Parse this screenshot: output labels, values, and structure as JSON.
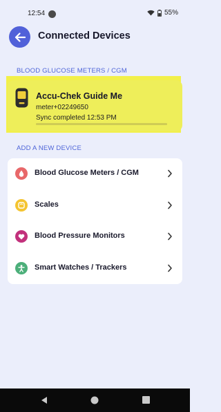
{
  "status_bar": {
    "time": "12:54",
    "battery": "55%"
  },
  "header": {
    "title": "Connected Devices",
    "back_icon": "arrow-left-icon"
  },
  "connected_section": {
    "heading": "BLOOD GLUCOSE METERS / CGM",
    "device": {
      "name": "Accu-Chek Guide Me",
      "serial": "meter+02249650",
      "sync_status": "Sync completed 12:53 PM",
      "icon": "glucose-meter-icon",
      "sync_progress": 1.0
    }
  },
  "add_section": {
    "heading": "ADD A NEW DEVICE",
    "items": [
      {
        "label": "Blood Glucose Meters / CGM",
        "icon": "blood-drop-icon",
        "color": "#e8686a"
      },
      {
        "label": "Scales",
        "icon": "scale-icon",
        "color": "#f4c430"
      },
      {
        "label": "Blood Pressure Monitors",
        "icon": "heart-icon",
        "color": "#c2317c"
      },
      {
        "label": "Smart Watches / Trackers",
        "icon": "person-activity-icon",
        "color": "#4caf7a"
      }
    ]
  },
  "colors": {
    "accent": "#5161d9",
    "background": "#ebeefb",
    "highlight": "#f2f04a"
  }
}
